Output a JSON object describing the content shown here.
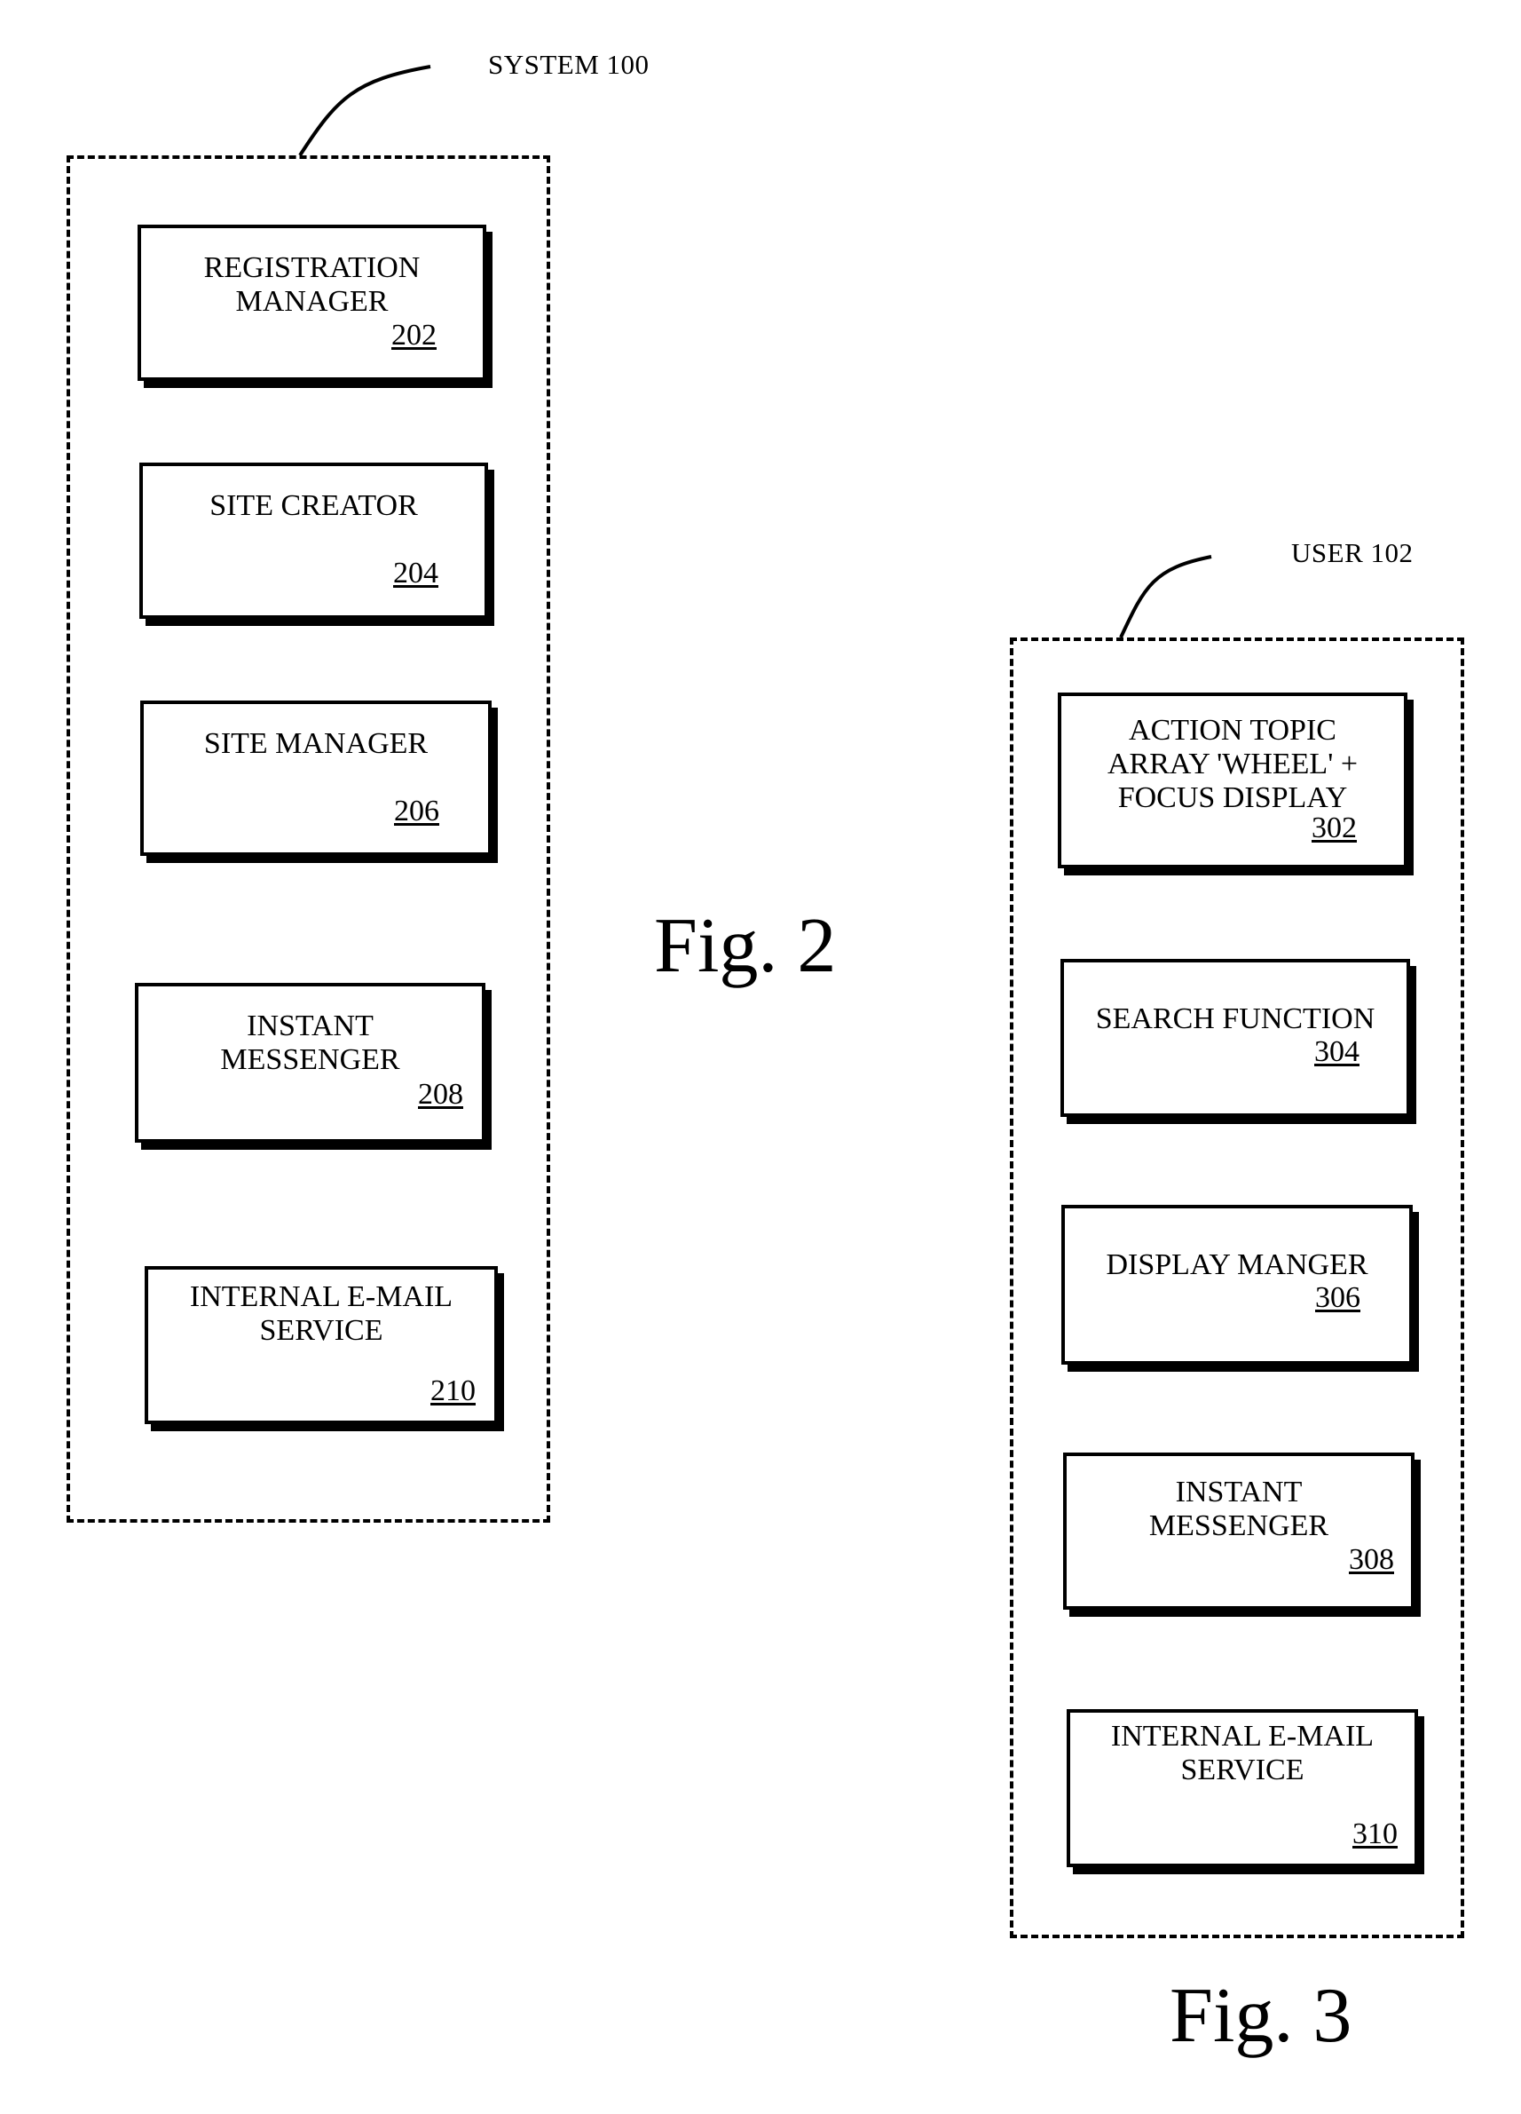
{
  "figures": [
    {
      "caption": "Fig. 2",
      "group_label": "SYSTEM 100",
      "components": [
        {
          "title": "REGISTRATION\nMANAGER",
          "ref": "202"
        },
        {
          "title": "SITE CREATOR",
          "ref": "204"
        },
        {
          "title": "SITE MANAGER",
          "ref": "206"
        },
        {
          "title": "INSTANT\nMESSENGER",
          "ref": "208"
        },
        {
          "title": "INTERNAL E-MAIL\nSERVICE",
          "ref": "210"
        }
      ]
    },
    {
      "caption": "Fig. 3",
      "group_label": "USER 102",
      "components": [
        {
          "title": "ACTION TOPIC\nARRAY 'WHEEL' +\nFOCUS DISPLAY",
          "ref": "302"
        },
        {
          "title": "SEARCH FUNCTION",
          "ref": "304"
        },
        {
          "title": "DISPLAY MANGER",
          "ref": "306"
        },
        {
          "title": "INSTANT\nMESSENGER",
          "ref": "308"
        },
        {
          "title": "INTERNAL  E-MAIL\nSERVICE",
          "ref": "310"
        }
      ]
    }
  ]
}
